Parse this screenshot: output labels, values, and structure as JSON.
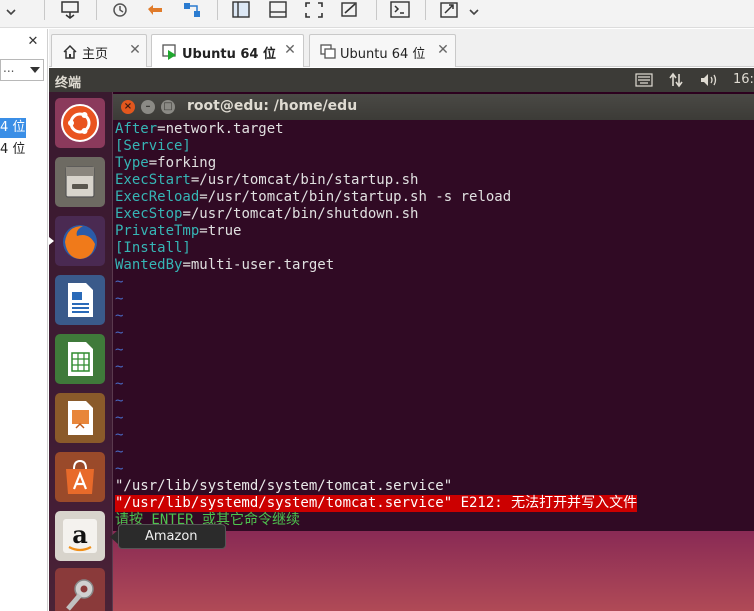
{
  "vmware": {
    "tabs": [
      {
        "label": "主页"
      },
      {
        "label": "Ubuntu 64 位"
      },
      {
        "label": "Ubuntu 64 位"
      }
    ],
    "close_glyph": "✕",
    "library": {
      "search_value": "...",
      "items": [
        {
          "label": "4 位"
        },
        {
          "label": "4 位"
        }
      ]
    }
  },
  "ubuntu": {
    "panel_title": "终端",
    "clock": "16:",
    "launcher": [
      {
        "icon": "ubuntu-dash-icon"
      },
      {
        "icon": "files-icon"
      },
      {
        "icon": "firefox-icon"
      },
      {
        "icon": "libreoffice-writer-icon"
      },
      {
        "icon": "libreoffice-calc-icon"
      },
      {
        "icon": "libreoffice-impress-icon"
      },
      {
        "icon": "software-center-icon"
      },
      {
        "icon": "amazon-icon"
      },
      {
        "icon": "system-settings-icon"
      }
    ],
    "tooltip": "Amazon"
  },
  "terminal": {
    "title": "root@edu: /home/edu",
    "lines": [
      {
        "key": "After",
        "value": "=network.target"
      },
      {
        "section": "[Service]"
      },
      {
        "key": "Type",
        "value": "=forking"
      },
      {
        "key": "ExecStart",
        "value": "=/usr/tomcat/bin/startup.sh"
      },
      {
        "key": "ExecReload",
        "value": "=/usr/tomcat/bin/startup.sh -s reload"
      },
      {
        "key": "ExecStop",
        "value": "=/usr/tomcat/bin/shutdown.sh"
      },
      {
        "key": "PrivateTmp",
        "value": "=true"
      },
      {
        "section": "[Install]"
      },
      {
        "key": "WantedBy",
        "value": "=multi-user.target"
      }
    ],
    "tilde": "~",
    "tilde_count": 12,
    "status_line": "\"/usr/lib/systemd/system/tomcat.service\"",
    "error_line": "\"/usr/lib/systemd/system/tomcat.service\" E212: 无法打开并写入文件",
    "hint_line": "请按 ENTER 或其它命令继续"
  },
  "colors": {
    "terminal_bg": "#300a24",
    "key": "#36b5b5",
    "tilde": "#4868c0",
    "error_bg": "#cc0000",
    "hint": "#4ec24e",
    "selection": "#3a8ee6"
  }
}
